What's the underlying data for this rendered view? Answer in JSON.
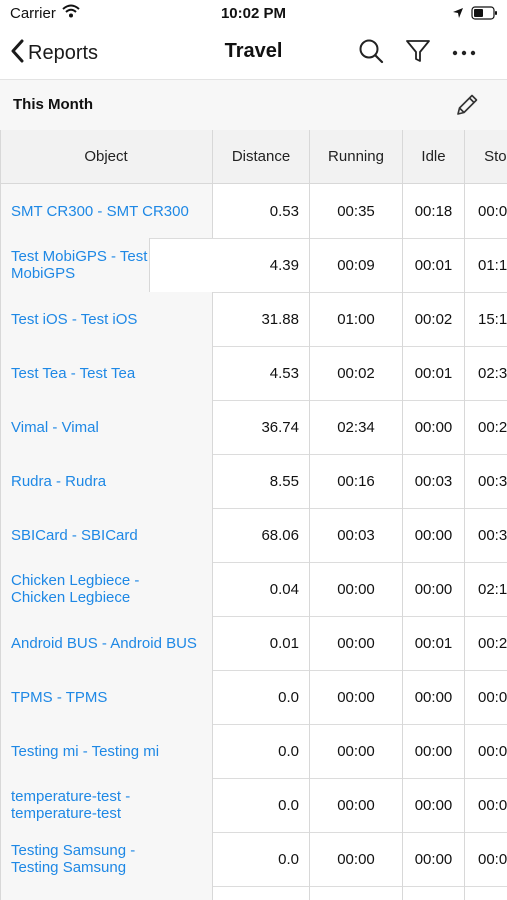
{
  "status": {
    "carrier": "Carrier",
    "time": "10:02 PM"
  },
  "nav": {
    "back_label": "Reports",
    "title": "Travel"
  },
  "subbar": {
    "period": "This Month"
  },
  "table": {
    "headers": [
      "Object",
      "Distance",
      "Running",
      "Idle",
      "Stop"
    ],
    "rows": [
      {
        "object": "SMT CR300 - SMT CR300",
        "distance": "0.53",
        "running": "00:35",
        "idle": "00:18",
        "stop": "00:0"
      },
      {
        "object": "Test MobiGPS - Test MobiGPS",
        "distance": "4.39",
        "running": "00:09",
        "idle": "00:01",
        "stop": "01:1"
      },
      {
        "object": "Test iOS - Test iOS",
        "distance": "31.88",
        "running": "01:00",
        "idle": "00:02",
        "stop": "15:1"
      },
      {
        "object": "Test Tea - Test Tea",
        "distance": "4.53",
        "running": "00:02",
        "idle": "00:01",
        "stop": "02:3"
      },
      {
        "object": "Vimal - Vimal",
        "distance": "36.74",
        "running": "02:34",
        "idle": "00:00",
        "stop": "00:2"
      },
      {
        "object": "Rudra - Rudra",
        "distance": "8.55",
        "running": "00:16",
        "idle": "00:03",
        "stop": "00:3"
      },
      {
        "object": "SBICard - SBICard",
        "distance": "68.06",
        "running": "00:03",
        "idle": "00:00",
        "stop": "00:3"
      },
      {
        "object": "Chicken Legbiece - Chicken Legbiece",
        "distance": "0.04",
        "running": "00:00",
        "idle": "00:00",
        "stop": "02:1"
      },
      {
        "object": "Android BUS - Android BUS",
        "distance": "0.01",
        "running": "00:00",
        "idle": "00:01",
        "stop": "00:2"
      },
      {
        "object": "TPMS - TPMS",
        "distance": "0.0",
        "running": "00:00",
        "idle": "00:00",
        "stop": "00:0"
      },
      {
        "object": "Testing mi - Testing mi",
        "distance": "0.0",
        "running": "00:00",
        "idle": "00:00",
        "stop": "00:0"
      },
      {
        "object": "temperature-test - temperature-test",
        "distance": "0.0",
        "running": "00:00",
        "idle": "00:00",
        "stop": "00:0"
      },
      {
        "object": "Testing Samsung - Testing Samsung",
        "distance": "0.0",
        "running": "00:00",
        "idle": "00:00",
        "stop": "00:0"
      },
      {
        "object": "",
        "distance": "",
        "running": "",
        "idle": "",
        "stop": ""
      }
    ]
  },
  "colors": {
    "link": "#1e88e5",
    "name_column_bg": "#f7f7f7",
    "header_bg": "#f2f2f2"
  }
}
